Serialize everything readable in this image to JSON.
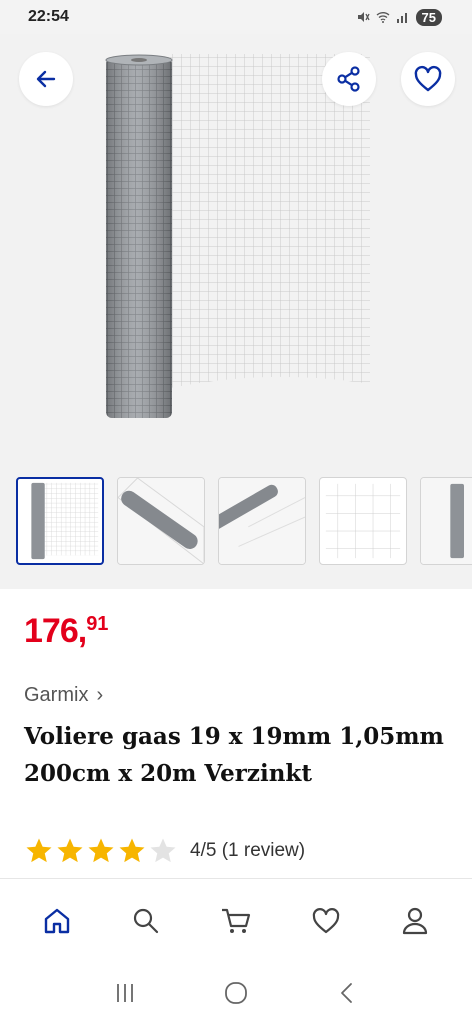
{
  "status_bar": {
    "time": "22:54",
    "battery": "75",
    "icons": [
      "mute-icon",
      "wifi-icon",
      "signal-icon"
    ]
  },
  "header": {
    "icons": [
      "back-arrow-icon",
      "share-icon",
      "heart-icon"
    ],
    "accent_color": "#0a2ea3"
  },
  "gallery": {
    "thumbnail_count": 5,
    "active_index": 0
  },
  "product": {
    "price_main": "176,",
    "price_cents": "91",
    "price_color": "#e3001b",
    "brand": "Garmix",
    "brand_chevron": "›",
    "title": "Voliere gaas 19 x 19mm 1,05mm 200cm x 20m Verzinkt",
    "rating_value": 4,
    "rating_max": 5,
    "rating_text": "4/5 (1 review)",
    "star_color": "#f7b500"
  },
  "bottom_nav": {
    "items": [
      "home-icon",
      "search-icon",
      "cart-icon",
      "wishlist-icon",
      "account-icon"
    ],
    "active": "home-icon"
  },
  "system_nav": {
    "items": [
      "recents-icon",
      "home-circle-icon",
      "back-chevron-icon"
    ]
  }
}
